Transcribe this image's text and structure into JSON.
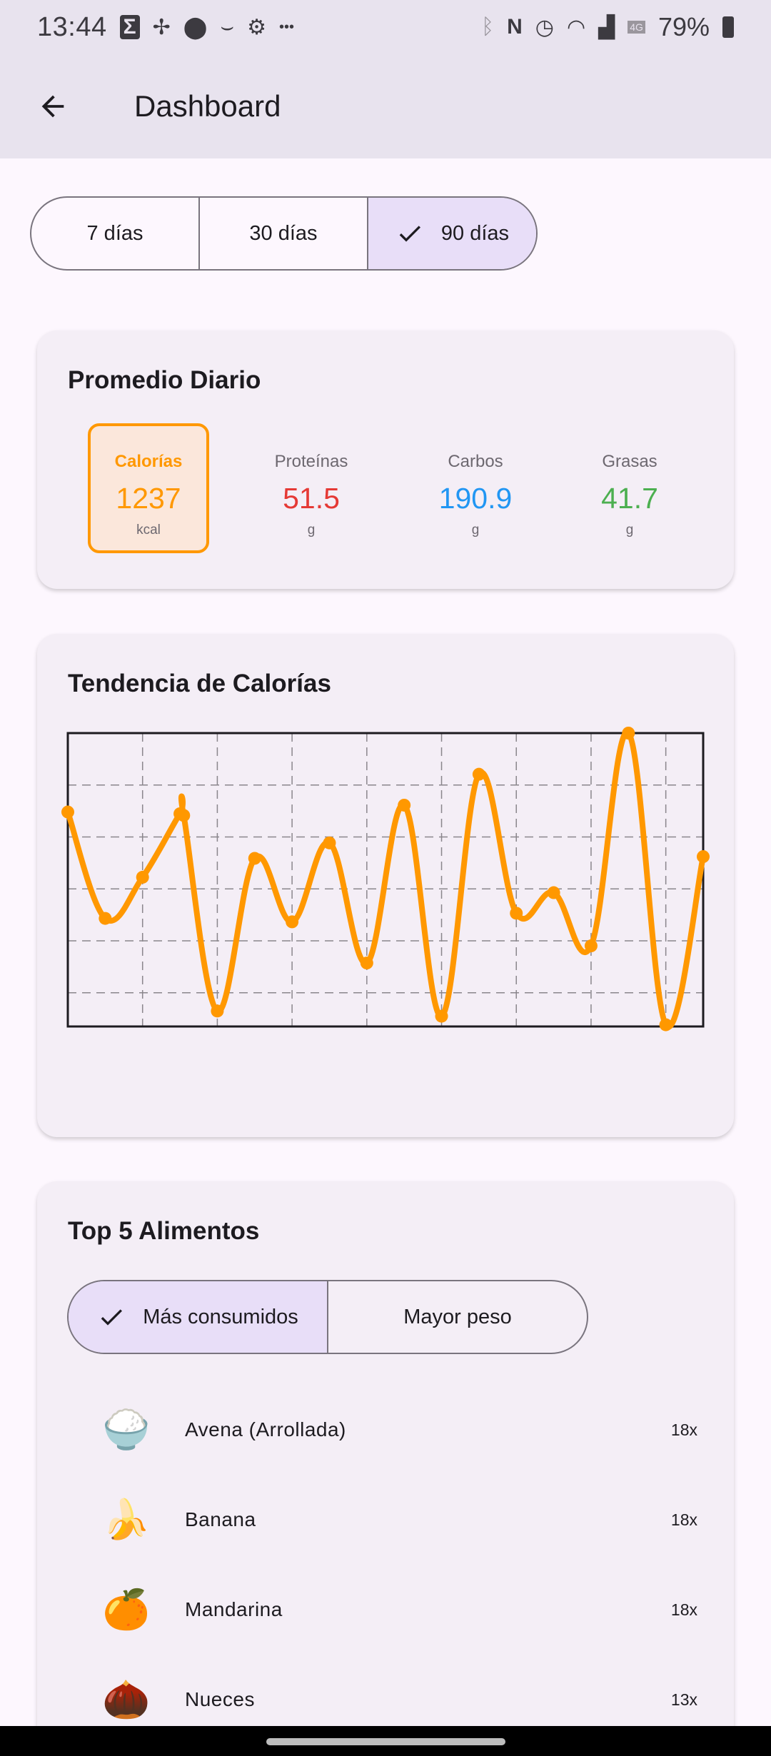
{
  "status_bar": {
    "time": "13:44",
    "left_icons": [
      "sigma-icon",
      "fan-icon",
      "location-icon",
      "amazon-icon",
      "settings-icon",
      "more-icon"
    ],
    "right_icons": [
      "bluetooth-icon",
      "nfc-icon",
      "alarm-icon",
      "wifi-icon",
      "signal-icon",
      "4g-icon"
    ],
    "battery": "79%"
  },
  "app_bar": {
    "title": "Dashboard",
    "back_icon": "arrow-back-icon"
  },
  "range_selector": {
    "options": [
      "7 días",
      "30 días",
      "90 días"
    ],
    "selected": "90 días",
    "check_icon": "check-icon"
  },
  "daily_average": {
    "title": "Promedio Diario",
    "macros": [
      {
        "label": "Calorías",
        "value": "1237",
        "unit": "kcal",
        "color": "#ff9800",
        "active": true
      },
      {
        "label": "Proteínas",
        "value": "51.5",
        "unit": "g",
        "color": "#e53935"
      },
      {
        "label": "Carbos",
        "value": "190.9",
        "unit": "g",
        "color": "#2196f3"
      },
      {
        "label": "Grasas",
        "value": "41.7",
        "unit": "g",
        "color": "#4caf50"
      }
    ]
  },
  "calorie_trend": {
    "title": "Tendencia de Calorías",
    "line_color": "#ff9800"
  },
  "chart_data": {
    "type": "line",
    "title": "Tendencia de Calorías",
    "xlabel": "",
    "ylabel": "",
    "grid": true,
    "x": [
      0,
      1,
      2,
      3,
      3.1,
      4,
      5,
      6,
      7,
      8,
      9,
      10,
      11,
      12,
      13,
      14,
      15,
      16,
      17
    ],
    "values": [
      1440,
      820,
      1060,
      1430,
      1420,
      280,
      1170,
      800,
      1260,
      560,
      1480,
      250,
      1660,
      850,
      970,
      660,
      1900,
      200,
      1180
    ],
    "ylim": [
      190,
      1900
    ]
  },
  "top_foods": {
    "title": "Top 5 Alimentos",
    "tabs": [
      "Más consumidos",
      "Mayor peso"
    ],
    "selected_tab": "Más consumidos",
    "items": [
      {
        "emoji": "🍚",
        "icon": "rice-bowl-icon",
        "name": "Avena (Arrollada)",
        "count": "18x"
      },
      {
        "emoji": "🍌",
        "icon": "banana-icon",
        "name": "Banana",
        "count": "18x"
      },
      {
        "emoji": "🍊",
        "icon": "tangerine-icon",
        "name": "Mandarina",
        "count": "18x"
      },
      {
        "emoji": "🌰",
        "icon": "chestnut-icon",
        "name": "Nueces",
        "count": "13x"
      }
    ]
  }
}
